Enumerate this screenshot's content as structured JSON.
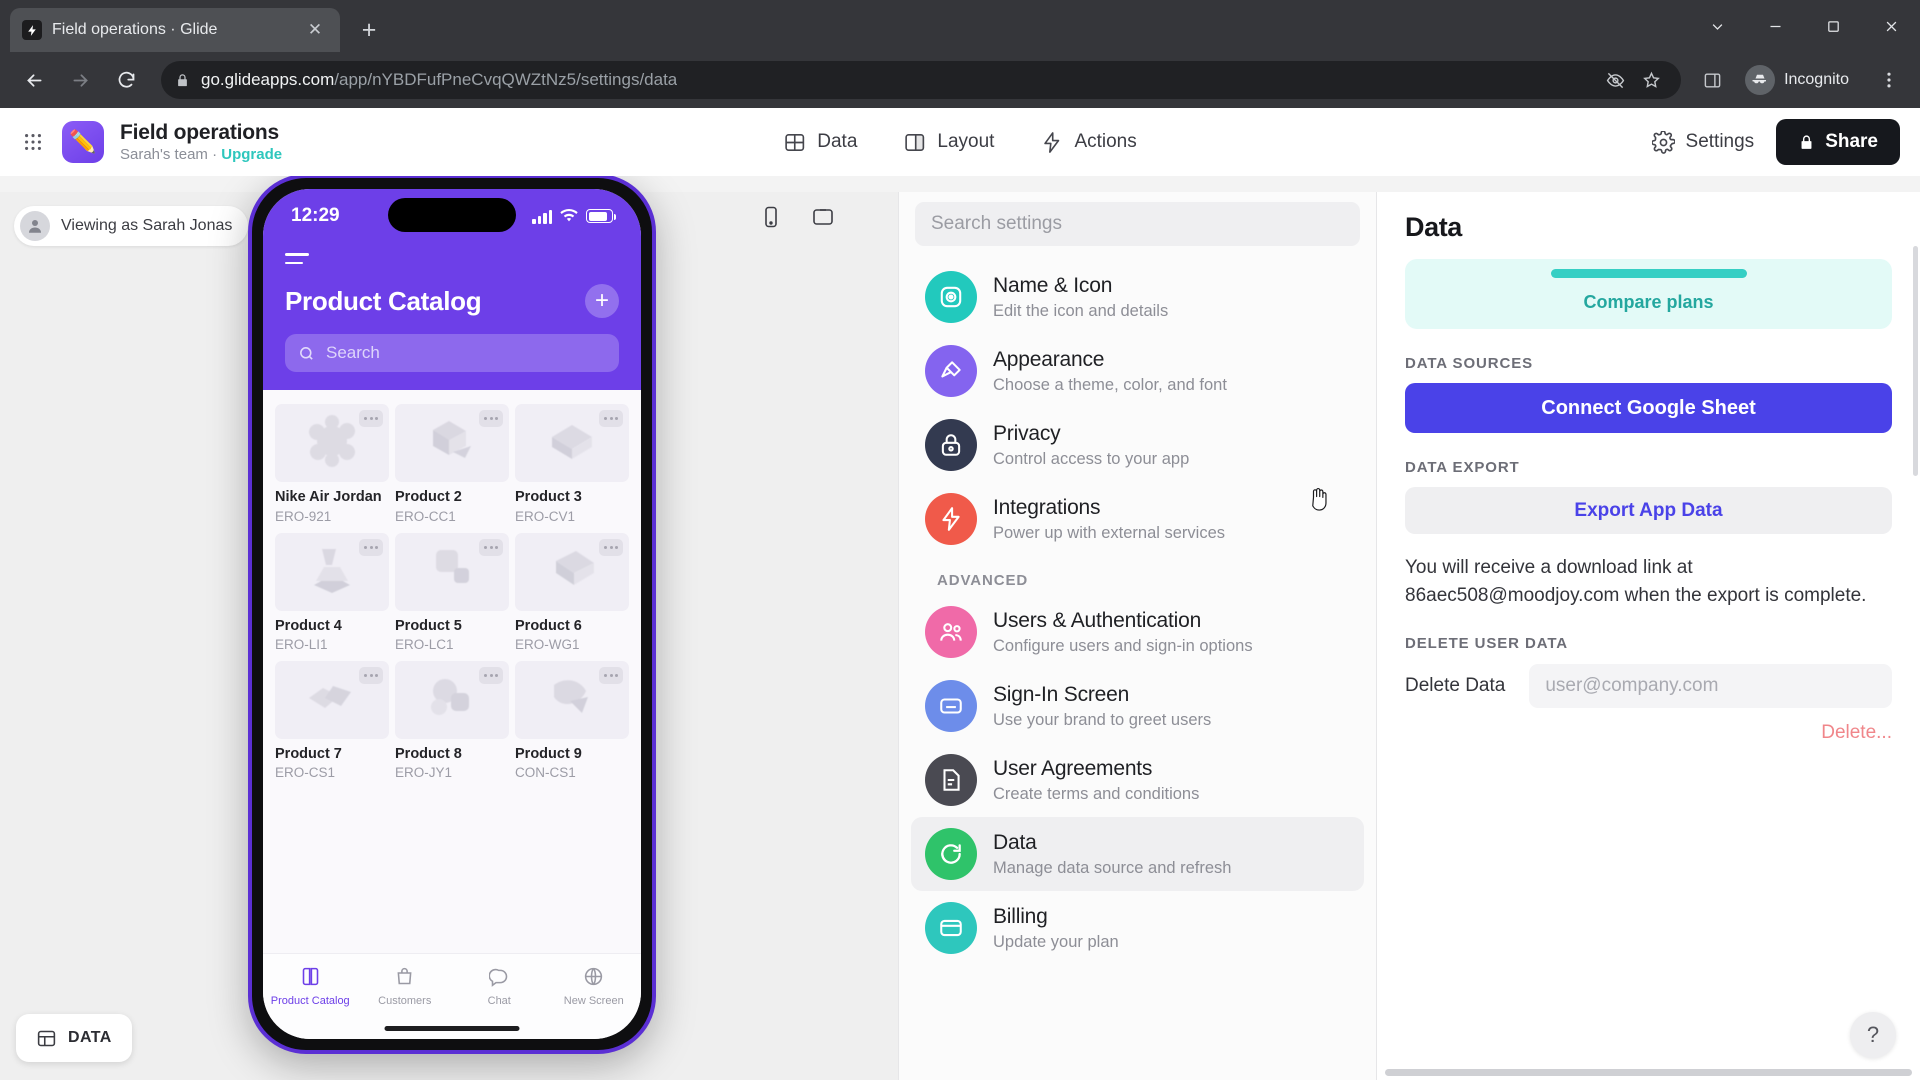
{
  "browser": {
    "tab_title": "Field operations · Glide",
    "new_tab_label": "+",
    "close_label": "✕",
    "url_host": "go.glideapps.com",
    "url_path": "/app/nYBDFufPneCvqQWZtNz5/settings/data",
    "profile_label": "Incognito"
  },
  "app_header": {
    "title": "Field operations",
    "team": "Sarah's team · ",
    "upgrade": "Upgrade",
    "nav": [
      {
        "label": "Data",
        "icon": "table-icon"
      },
      {
        "label": "Layout",
        "icon": "layout-icon"
      },
      {
        "label": "Actions",
        "icon": "bolt-icon"
      }
    ],
    "settings_label": "Settings",
    "share_label": "Share"
  },
  "stage": {
    "viewing_as": "Viewing as Sarah Jonas",
    "data_pill": "DATA"
  },
  "phone": {
    "time": "12:29",
    "screen_title": "Product Catalog",
    "search_placeholder": "Search",
    "add_label": "+",
    "products": [
      {
        "name": "Nike Air Jordan",
        "code": "ERO-921"
      },
      {
        "name": "Product 2",
        "code": "ERO-CC1"
      },
      {
        "name": "Product 3",
        "code": "ERO-CV1"
      },
      {
        "name": "Product 4",
        "code": "ERO-LI1"
      },
      {
        "name": "Product 5",
        "code": "ERO-LC1"
      },
      {
        "name": "Product 6",
        "code": "ERO-WG1"
      },
      {
        "name": "Product 7",
        "code": "ERO-CS1"
      },
      {
        "name": "Product 8",
        "code": "ERO-JY1"
      },
      {
        "name": "Product 9",
        "code": "CON-CS1"
      }
    ],
    "bottom_nav": [
      {
        "label": "Product Catalog",
        "icon": "book-icon",
        "active": true
      },
      {
        "label": "Customers",
        "icon": "bag-icon",
        "active": false
      },
      {
        "label": "Chat",
        "icon": "chat-icon",
        "active": false
      },
      {
        "label": "New Screen",
        "icon": "globe-icon",
        "active": false
      }
    ]
  },
  "settings": {
    "search_placeholder": "Search settings",
    "items": [
      {
        "title": "Name & Icon",
        "desc": "Edit the icon and details",
        "color": "#22c9bd",
        "icon": "aperture-icon"
      },
      {
        "title": "Appearance",
        "desc": "Choose a theme, color, and font",
        "color": "#8464ef",
        "icon": "brush-icon"
      },
      {
        "title": "Privacy",
        "desc": "Control access to your app",
        "color": "#333a50",
        "icon": "lock-icon"
      },
      {
        "title": "Integrations",
        "desc": "Power up with external services",
        "color": "#f05a4a",
        "icon": "bolt-icon"
      }
    ],
    "advanced_label": "ADVANCED",
    "advanced_items": [
      {
        "title": "Users & Authentication",
        "desc": "Configure users and sign-in options",
        "color": "#f06aa8",
        "icon": "users-icon"
      },
      {
        "title": "Sign-In Screen",
        "desc": "Use your brand to greet users",
        "color": "#6d8dea",
        "icon": "card-icon"
      },
      {
        "title": "User Agreements",
        "desc": "Create terms and conditions",
        "color": "#4a4a52",
        "icon": "doc-icon"
      },
      {
        "title": "Data",
        "desc": "Manage data source and refresh",
        "color": "#2fc36a",
        "icon": "refresh-icon",
        "active": true
      },
      {
        "title": "Billing",
        "desc": "Update your plan",
        "color": "#2ec7bd",
        "icon": "card2-icon"
      }
    ]
  },
  "data_panel": {
    "title": "Data",
    "compare_plans": "Compare plans",
    "data_sources_label": "DATA SOURCES",
    "connect_button": "Connect Google Sheet",
    "data_export_label": "DATA EXPORT",
    "export_button": "Export App Data",
    "export_note": "You will receive a download link at 86aec508@moodjoy.com when the export is complete.",
    "delete_user_data_label": "DELETE USER DATA",
    "delete_label": "Delete Data",
    "delete_placeholder": "user@company.com",
    "delete_action": "Delete...",
    "help_label": "?"
  }
}
